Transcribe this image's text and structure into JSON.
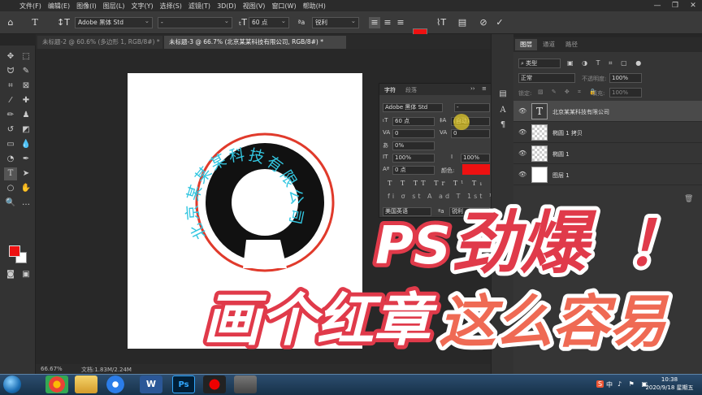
{
  "menubar": {
    "items": [
      "文件(F)",
      "编辑(E)",
      "图像(I)",
      "图层(L)",
      "文字(Y)",
      "选择(S)",
      "滤镜(T)",
      "3D(D)",
      "视图(V)",
      "窗口(W)",
      "帮助(H)"
    ],
    "ps_logo": "Ps"
  },
  "options_bar": {
    "font_family": "Adobe 黑体 Std",
    "font_style": "-",
    "font_size": "60 点",
    "antialias": "锐利",
    "aa_label": "ªa",
    "text_color": "#ee1111"
  },
  "tabs": [
    {
      "label": "未标题-2 @ 60.6% (多边形 1, RGB/8#) *",
      "active": false
    },
    {
      "label": "未标题-3 @ 66.7% (北京某某科技有限公司, RGB/8#) *",
      "active": true
    }
  ],
  "status": {
    "zoom": "66.67%",
    "doc": "文档:1.83M/2.24M"
  },
  "character_panel": {
    "tabs": [
      "字符",
      "段落"
    ],
    "font_family": "Adobe 黑体 Std",
    "font_style": "-",
    "size": "60 点",
    "leading": "(自动)",
    "kerning": "0",
    "tracking": "0",
    "scale_tsume": "0%",
    "vertical_scale": "100%",
    "horizontal_scale": "100%",
    "baseline": "0 点",
    "color_label": "颜色:",
    "color": "#ee1111",
    "language": "美国英语",
    "antialias": "锐利",
    "aa_label": "ªa",
    "style_buttons": [
      "T",
      "T",
      "TT",
      "Tr",
      "T¹",
      "T₁",
      "T",
      "T̶"
    ],
    "ot_buttons": [
      "fi",
      "σ",
      "st",
      "A",
      "ad",
      "T",
      "1st",
      "½"
    ]
  },
  "layers_panel": {
    "tabs": [
      "图层",
      "通道",
      "路径"
    ],
    "filter_label": "类型",
    "blend_mode": "正常",
    "opacity_label": "不透明度:",
    "opacity": "100%",
    "lock_label": "锁定:",
    "fill_label": "填充:",
    "fill": "100%",
    "layers": [
      {
        "name": "北京某某科技有限公司",
        "type": "text"
      },
      {
        "name": "椭圆 1 拷贝",
        "type": "shape"
      },
      {
        "name": "椭圆 1",
        "type": "shape"
      },
      {
        "name": "图层 1",
        "type": "pixel"
      }
    ]
  },
  "canvas": {
    "arc_text": "北京某某某科技有限公司",
    "ring_color": "#e03a2b",
    "text_color": "#33c6e0"
  },
  "overlay": {
    "line1_ps": "PS",
    "line1_big": "劲爆",
    "line1_excl": "！",
    "line2_white": "画个红章",
    "line2_orange": "这么容易"
  },
  "taskbar": {
    "time": "10:38",
    "date": "2020/9/18 星期五",
    "ime": "中"
  }
}
